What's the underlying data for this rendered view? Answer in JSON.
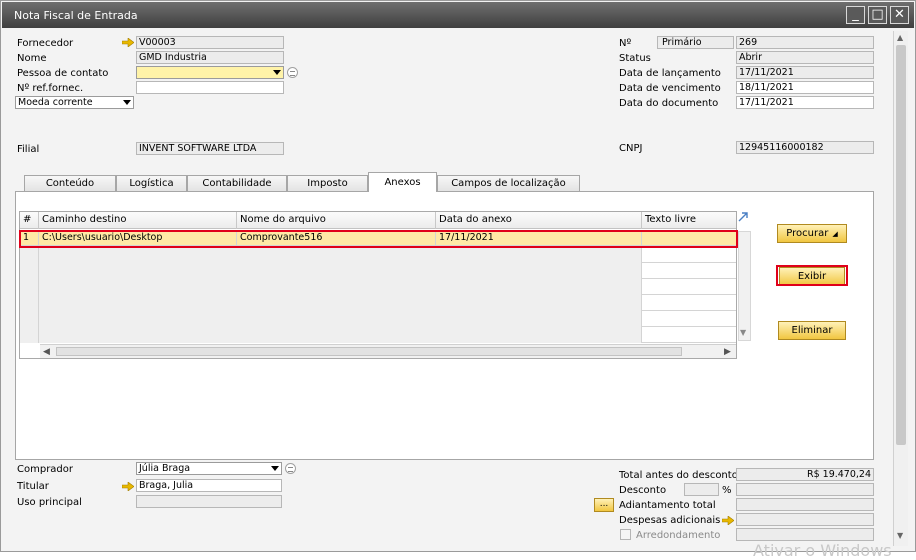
{
  "window": {
    "title": "Nota Fiscal de Entrada",
    "minimize": "_",
    "maximize": "□",
    "close": "✕"
  },
  "header_left": {
    "fornecedor_label": "Fornecedor",
    "fornecedor_value": "V00003",
    "nome_label": "Nome",
    "nome_value": "GMD Industria",
    "pessoa_label": "Pessoa de contato",
    "pessoa_value": "",
    "ref_label": "Nº ref.fornec.",
    "ref_value": "",
    "moeda_value": "Moeda corrente"
  },
  "header_right": {
    "numero_label": "Nº",
    "serie_value": "Primário",
    "numero_value": "269",
    "status_label": "Status",
    "status_value": "Abrir",
    "lancamento_label": "Data de lançamento",
    "lancamento_value": "17/11/2021",
    "vencimento_label": "Data de vencimento",
    "vencimento_value": "18/11/2021",
    "documento_label": "Data do documento",
    "documento_value": "17/11/2021"
  },
  "filial": {
    "label": "Filial",
    "value": "INVENT SOFTWARE LTDA",
    "cnpj_label": "CNPJ",
    "cnpj_value": "12945116000182"
  },
  "tabs": [
    "Conteúdo",
    "Logística",
    "Contabilidade",
    "Imposto",
    "Anexos",
    "Campos de localização"
  ],
  "active_tab": "Anexos",
  "attachments": {
    "columns": [
      "#",
      "Caminho destino",
      "Nome do arquivo",
      "Data do anexo",
      "Texto livre"
    ],
    "rows": [
      {
        "num": "1",
        "path": "C:\\Users\\usuario\\Desktop",
        "file": "Comprovante516",
        "date": "17/11/2021",
        "text": ""
      }
    ]
  },
  "buttons": {
    "procurar": "Procurar",
    "exibir": "Exibir",
    "eliminar": "Eliminar"
  },
  "footer_left": {
    "comprador_label": "Comprador",
    "comprador_value": "Júlia Braga",
    "titular_label": "Titular",
    "titular_value": "Braga, Julia",
    "uso_label": "Uso principal",
    "uso_value": ""
  },
  "footer_right": {
    "total_label": "Total antes do desconto",
    "total_value": "R$ 19.470,24",
    "desconto_label": "Desconto",
    "desconto_pct": "%",
    "adiantamento_label": "Adiantamento total",
    "despesas_label": "Despesas adicionais",
    "arredondamento_label": "Arredondamento",
    "ellipsis": "..."
  },
  "watermark": "Ativar o Windows",
  "colors": {
    "highlight": "#e0001a",
    "selected_row": "#ffe9a6",
    "button": "#f1c640",
    "link_arrow": "#e8b800"
  }
}
